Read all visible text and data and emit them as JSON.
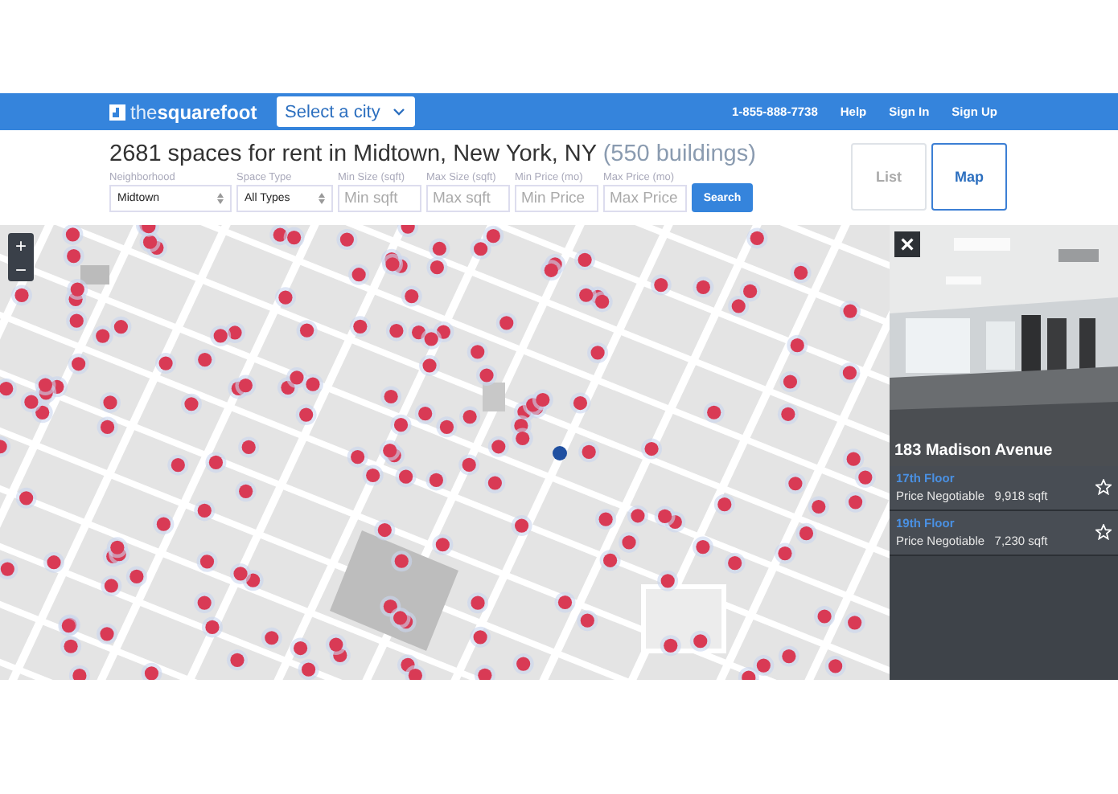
{
  "header": {
    "logo_light": "the",
    "logo_bold": "squarefoot",
    "city_select": "Select a city",
    "links": [
      "1-855-888-7738",
      "Help",
      "Sign In",
      "Sign Up"
    ]
  },
  "search": {
    "headline": "2681 spaces for rent in Midtown, New York, NY",
    "count": "(550 buildings)",
    "filters": [
      {
        "kind": "select",
        "label": "Neighborhood",
        "value": "Midtown"
      },
      {
        "kind": "select",
        "label": "Space Type",
        "value": "All Types"
      },
      {
        "kind": "input",
        "label": "Min Size (sqft)",
        "placeholder": "Min sqft"
      },
      {
        "kind": "input",
        "label": "Max Size (sqft)",
        "placeholder": "Max sqft"
      },
      {
        "kind": "input",
        "label": "Min Price (mo)",
        "placeholder": "Min Price"
      },
      {
        "kind": "input",
        "label": "Max Price (mo)",
        "placeholder": "Max Price"
      }
    ],
    "button": "Search"
  },
  "view_toggle": [
    {
      "label": "List",
      "selected": false
    },
    {
      "label": "Map",
      "selected": true
    }
  ],
  "map": {
    "zoom_in": "+",
    "zoom_out": "−"
  },
  "panel": {
    "close": "×",
    "building": "183 Madison Avenue",
    "listings": [
      {
        "floor": "17th Floor",
        "price": "Price Negotiable",
        "size": "9,918 sqft",
        "starred": false
      },
      {
        "floor": "19th Floor",
        "price": "Price Negotiable",
        "size": "7,230 sqft",
        "starred": false
      }
    ]
  }
}
